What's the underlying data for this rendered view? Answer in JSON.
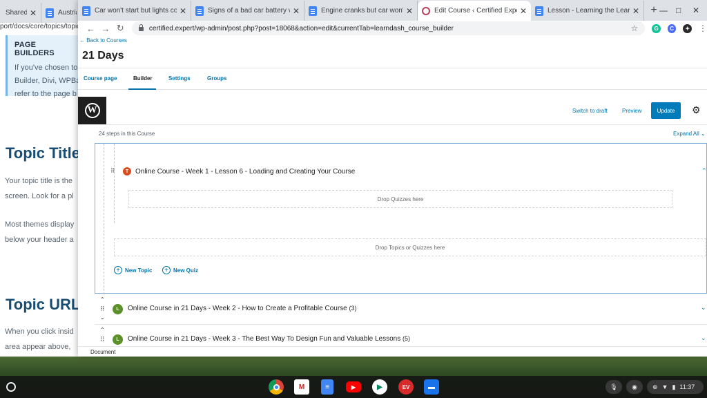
{
  "bg_window": {
    "tabs": [
      {
        "label": "Shared Su"
      },
      {
        "label": "Austria I"
      }
    ],
    "address_fragment": "port/docs/core/topics/topic",
    "callout": {
      "heading": "PAGE BUILDERS",
      "lines": [
        "If you've chosen to",
        "Builder, Divi, WPBa",
        "refer to the page b"
      ]
    },
    "topic_title_heading": "Topic Title",
    "topic_title_lines": [
      "Your topic title is the",
      "screen. Look for a pl"
    ],
    "theme_lines": [
      "Most themes display",
      "below your header a"
    ],
    "topic_url_heading": "Topic URL",
    "topic_url_lines": [
      "When you click insid",
      "area appear above,"
    ]
  },
  "fg_window": {
    "tabs": [
      {
        "label": "Car won't start but lights come o",
        "icon": "docs-icon"
      },
      {
        "label": "Signs of a bad car battery vs. alte",
        "icon": "docs-icon"
      },
      {
        "label": "Engine cranks but car won't start",
        "icon": "docs-icon"
      },
      {
        "label": "Edit Course ‹ Certified Expert — V",
        "icon": "wordpress-icon",
        "active": true
      },
      {
        "label": "Lesson - Learning the LearnDash",
        "icon": "docs-icon"
      }
    ],
    "new_tab": "+",
    "window_controls": {
      "minimize": "—",
      "maximize": "□",
      "close": "✕"
    },
    "url": "certified.expert/wp-admin/post.php?post=18068&action=edit&currentTab=learndash_course_builder",
    "nav": {
      "back": "←",
      "forward": "→",
      "reload": "↻"
    },
    "star": "☆",
    "extensions": [
      {
        "label": "G",
        "color": "#15c39a"
      },
      {
        "label": "C",
        "color": "#4a6cf7"
      },
      {
        "label": "✦",
        "color": "#2a2a2a"
      }
    ],
    "menu": "⋮"
  },
  "page": {
    "back_link": "← Back to Courses",
    "course_title": "21 Days",
    "tabs": [
      "Course page",
      "Builder",
      "Settings",
      "Groups"
    ],
    "active_tab": "Builder",
    "toolbar": {
      "switch_to_draft": "Switch to draft",
      "preview": "Preview",
      "update": "Update",
      "settings_icon": "⚙"
    },
    "steps_count": "24 steps in this Course",
    "expand_all": "Expand All",
    "expanded_lesson": {
      "badge": "T",
      "badge_color": "#d54e21",
      "title": "Online Course - Week 1 - Lesson 6 - Loading and Creating Your Course",
      "drop_quizzes": "Drop Quizzes here",
      "drop_topics": "Drop Topics or Quizzes here",
      "new_topic": "New Topic",
      "new_quiz": "New Quiz"
    },
    "lessons": [
      {
        "badge": "L",
        "title": "Online Course in 21 Days - Week 2 - How to Create a Profitable Course",
        "count": "(3)"
      },
      {
        "badge": "L",
        "title": "Online Course in 21 Days - Week 3 - The Best Way To Design Fun and Valuable Lessons",
        "count": "(5)"
      }
    ],
    "lesson_badge_color": "#5a8f29",
    "footer_label": "Document"
  },
  "shelf": {
    "apps": [
      {
        "name": "chrome",
        "color": "#db4437",
        "label": ""
      },
      {
        "name": "gmail",
        "color": "#c5221f",
        "label": "M"
      },
      {
        "name": "docs",
        "color": "#4285f4",
        "label": "≡"
      },
      {
        "name": "youtube",
        "color": "#ff0000",
        "label": "▶"
      },
      {
        "name": "play-store",
        "color": "#01875f",
        "label": "▶"
      },
      {
        "name": "evernote-web-clipper",
        "color": "#d92b2b",
        "label": "EV"
      },
      {
        "name": "files",
        "color": "#1a73e8",
        "label": "▬"
      }
    ],
    "time": "11:37"
  }
}
